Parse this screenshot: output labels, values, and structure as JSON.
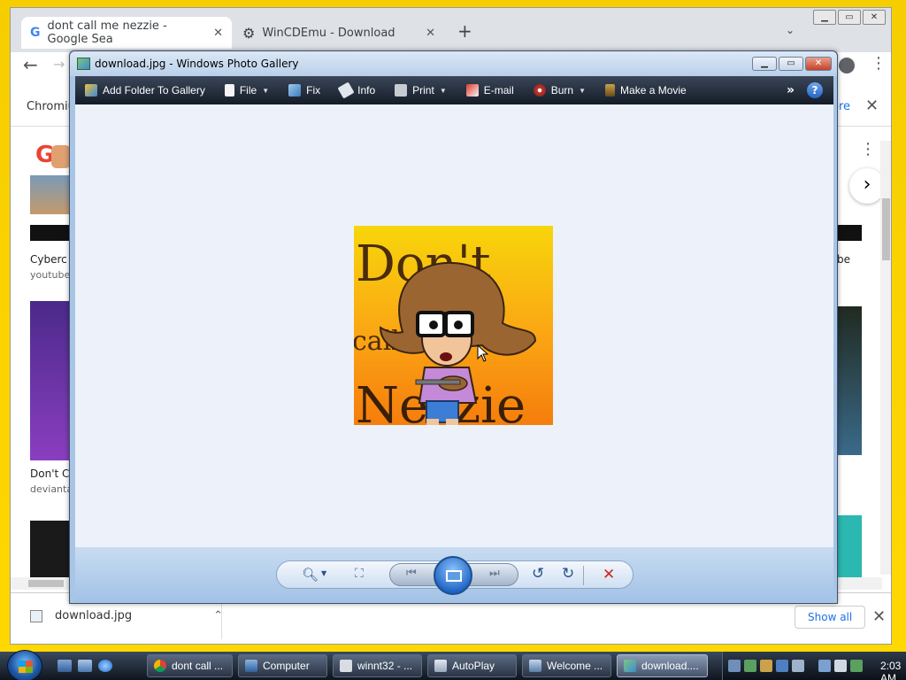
{
  "browser": {
    "tabs": [
      {
        "title": "dont call me nezzie - Google Sea",
        "icon": "google-icon",
        "active": true
      },
      {
        "title": "WinCDEmu - Download",
        "icon": "gear-icon",
        "active": false
      }
    ],
    "infobar_text": "Chromiu",
    "infobar_link": "ore",
    "results": [
      {
        "title": "Cyberc",
        "source": "youtube"
      },
      {
        "title": "Don't C",
        "source": "devianta"
      },
      {
        "title": "be",
        "source": ""
      }
    ],
    "download_file": "download.jpg",
    "show_all": "Show all"
  },
  "gallery": {
    "title": "download.jpg - Windows Photo Gallery",
    "toolbar": {
      "add_folder": "Add Folder To Gallery",
      "file": "File",
      "fix": "Fix",
      "info": "Info",
      "print": "Print",
      "email": "E-mail",
      "burn": "Burn",
      "make_movie": "Make a Movie",
      "more": "»",
      "help": "?"
    },
    "image_text": {
      "line1": "Don't",
      "line2": "call me",
      "line3": "Nezzie"
    }
  },
  "taskbar": {
    "items": [
      {
        "label": "dont call ...",
        "icon": "chrome-icon",
        "active": false
      },
      {
        "label": "Computer",
        "icon": "computer-icon",
        "active": false
      },
      {
        "label": "winnt32 - ...",
        "icon": "document-icon",
        "active": false
      },
      {
        "label": "AutoPlay",
        "icon": "autoplay-icon",
        "active": false
      },
      {
        "label": "Welcome ...",
        "icon": "window-icon",
        "active": false
      },
      {
        "label": "download....",
        "icon": "photo-gallery-icon",
        "active": true
      }
    ],
    "clock": "2:03 AM"
  }
}
